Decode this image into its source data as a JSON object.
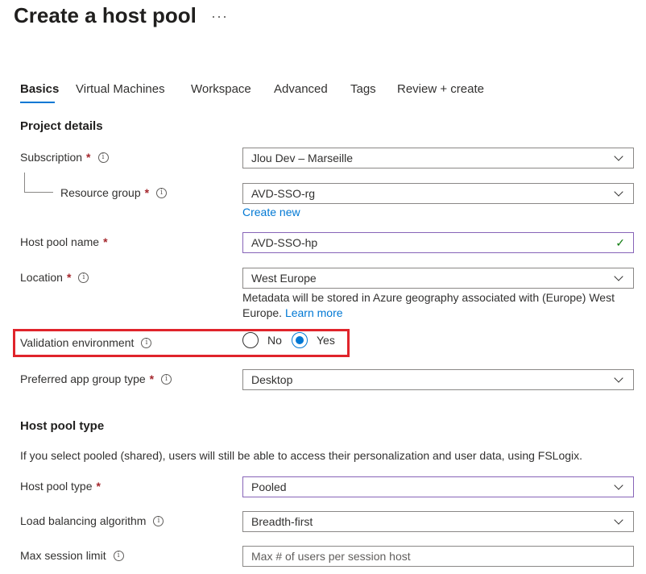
{
  "header": {
    "title": "Create a host pool",
    "more": "···"
  },
  "tabs": [
    "Basics",
    "Virtual Machines",
    "Workspace",
    "Advanced",
    "Tags",
    "Review + create"
  ],
  "project_details": {
    "heading": "Project details",
    "subscription": {
      "label": "Subscription",
      "value": "Jlou Dev – Marseille"
    },
    "resource_group": {
      "label": "Resource group",
      "value": "AVD-SSO-rg",
      "create_new": "Create new"
    },
    "host_pool_name": {
      "label": "Host pool name",
      "value": "AVD-SSO-hp"
    },
    "location": {
      "label": "Location",
      "value": "West Europe",
      "helper": "Metadata will be stored in Azure geography associated with (Europe) West Europe.",
      "learn_more": "Learn more"
    },
    "validation_environment": {
      "label": "Validation environment",
      "options": [
        "No",
        "Yes"
      ],
      "selected": "Yes"
    },
    "preferred_app_group_type": {
      "label": "Preferred app group type",
      "value": "Desktop"
    }
  },
  "host_pool_type_section": {
    "heading": "Host pool type",
    "description": "If you select pooled (shared), users will still be able to access their personalization and user data, using FSLogix.",
    "host_pool_type": {
      "label": "Host pool type",
      "value": "Pooled"
    },
    "load_balancing": {
      "label": "Load balancing algorithm",
      "value": "Breadth-first"
    },
    "max_session": {
      "label": "Max session limit",
      "placeholder": "Max # of users per session host"
    }
  },
  "symbols": {
    "required": "*",
    "info": "i",
    "check": "✓"
  },
  "colors": {
    "accent": "#0078d4",
    "highlight_box": "#e0242b",
    "required": "#a4262c",
    "valid": "#107c10"
  }
}
